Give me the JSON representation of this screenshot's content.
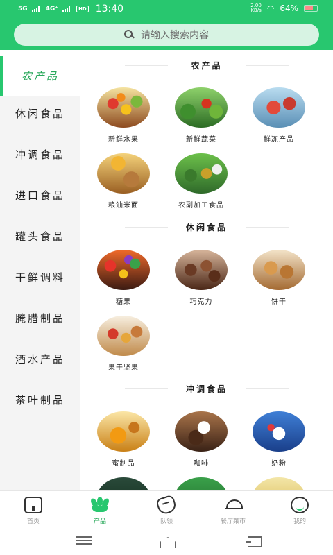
{
  "status_bar": {
    "network_1": "5G",
    "network_2": "4G⁺",
    "hd_badge": "HD",
    "time": "13:40",
    "speed_value": "2.00",
    "speed_unit": "KB/s",
    "battery": "64%"
  },
  "search": {
    "placeholder": "请输入搜索内容"
  },
  "sidebar": {
    "items": [
      {
        "label": "农产品",
        "active": true
      },
      {
        "label": "休闲食品"
      },
      {
        "label": "冲调食品"
      },
      {
        "label": "进口食品"
      },
      {
        "label": "罐头食品"
      },
      {
        "label": "干鲜调料"
      },
      {
        "label": "腌腊制品"
      },
      {
        "label": "酒水产品"
      },
      {
        "label": "茶叶制品"
      }
    ]
  },
  "sections": [
    {
      "title": "农产品",
      "products": [
        "新鲜水果",
        "新鲜蔬菜",
        "鲜冻产品",
        "粮油米面",
        "农副加工食品"
      ]
    },
    {
      "title": "休闲食品",
      "products": [
        "糖果",
        "巧克力",
        "饼干",
        "果干坚果"
      ]
    },
    {
      "title": "冲调食品",
      "products": [
        "蜜制品",
        "咖啡",
        "奶粉"
      ]
    }
  ],
  "bottom_nav": {
    "items": [
      {
        "label": "首页",
        "icon": "home-icon"
      },
      {
        "label": "产品",
        "icon": "product-icon",
        "active": true
      },
      {
        "label": "队领",
        "icon": "team-icon"
      },
      {
        "label": "餐厅菜市",
        "icon": "restaurant-icon"
      },
      {
        "label": "我的",
        "icon": "me-icon"
      }
    ]
  },
  "colors": {
    "brand": "#28c76f",
    "search_bg": "#d7f3e3",
    "sidebar_bg": "#f4f4f4",
    "active_text": "#28a85a"
  }
}
